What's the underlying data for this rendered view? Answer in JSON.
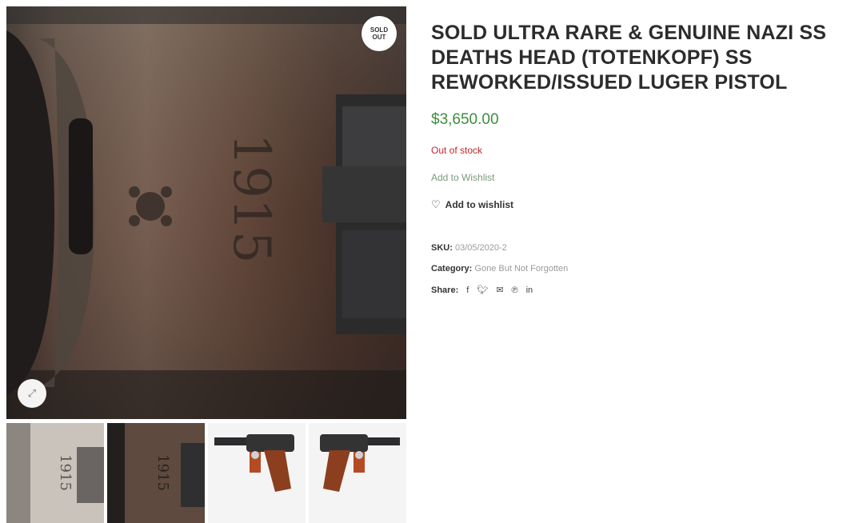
{
  "gallery": {
    "badge_line1": "SOLD",
    "badge_line2": "OUT",
    "main_image_text": "1915",
    "zoom_icon": "expand-icon",
    "thumbnails": [
      {
        "name": "thumb-1",
        "text": "1915"
      },
      {
        "name": "thumb-2",
        "text": "1915"
      },
      {
        "name": "thumb-3"
      },
      {
        "name": "thumb-4"
      }
    ]
  },
  "product": {
    "title": "SOLD ULTRA RARE & GENUINE NAZI SS DEATHS HEAD (TOTENKOPF) SS REWORKED/ISSUED LUGER PISTOL",
    "price": "$3,650.00",
    "stock_status": "Out of stock",
    "add_to_wishlist_link": "Add to Wishlist",
    "add_to_wishlist_button": "Add to wishlist",
    "sku_label": "SKU:",
    "sku_value": "03/05/2020-2",
    "category_label": "Category:",
    "category_value": "Gone But Not Forgotten",
    "share_label": "Share:",
    "share_icons": [
      "facebook-icon",
      "twitter-icon",
      "email-icon",
      "pinterest-icon",
      "linkedin-icon"
    ]
  },
  "colors": {
    "price": "#3c8d3c",
    "stock": "#c0272d",
    "title": "#2c2c2c"
  }
}
